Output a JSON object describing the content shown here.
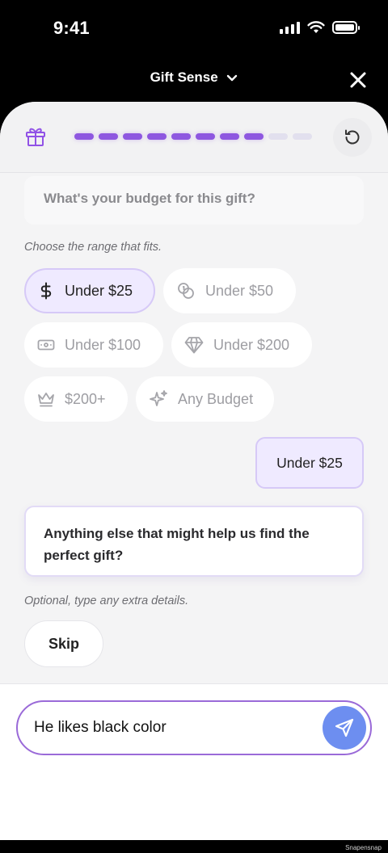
{
  "status_bar": {
    "time": "9:41"
  },
  "nav": {
    "title": "Gift Sense"
  },
  "progress": {
    "total_steps": 10,
    "completed_steps": 8
  },
  "chat": {
    "question": "What's your budget for this gift?",
    "budget_hint": "Choose the range that fits.",
    "budget_options": [
      {
        "label": "Under $25",
        "icon": "dollar-icon",
        "selected": true
      },
      {
        "label": "Under $50",
        "icon": "coins-icon",
        "selected": false
      },
      {
        "label": "Under $100",
        "icon": "banknote-icon",
        "selected": false
      },
      {
        "label": "Under $200",
        "icon": "gem-icon",
        "selected": false
      },
      {
        "label": "$200+",
        "icon": "crown-icon",
        "selected": false
      },
      {
        "label": "Any Budget",
        "icon": "sparkles-icon",
        "selected": false
      }
    ],
    "user_reply": "Under $25",
    "followup_question": "Anything else that might help us find the perfect gift?",
    "followup_hint": "Optional, type any extra details.",
    "skip_label": "Skip"
  },
  "composer": {
    "value": "He likes black color"
  },
  "colors": {
    "accent": "#8e57e0",
    "send_button": "#6d8ef0",
    "selected_chip_bg": "#efeaff"
  },
  "watermark": "Snapensnap"
}
